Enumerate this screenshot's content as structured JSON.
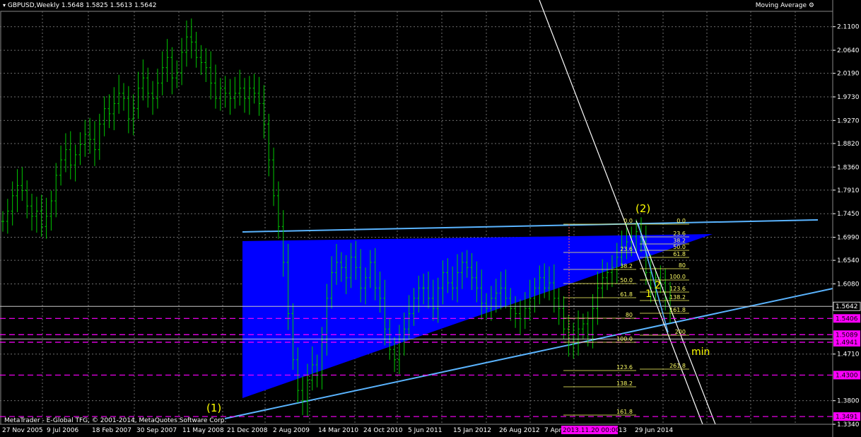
{
  "header": {
    "symbol_info": "GBPUSD,Weekly  1.5648 1.5825 1.5613 1.5642",
    "indicator": "Moving Average",
    "copyright": "MetaTrader - E-Global TFG, © 2001-2014, MetaQuotes Software Corp."
  },
  "colors": {
    "background": "#000000",
    "candles": "#00c800",
    "triangle": "#0000ff",
    "trendline": "#5ab4ff",
    "fib": "#ffff66",
    "magenta": "#ff00ff",
    "white": "#ffffff"
  },
  "chart_data": {
    "type": "candlestick",
    "symbol": "GBPUSD",
    "timeframe": "Weekly",
    "last_price": "1.5642",
    "ylim": [
      1.334,
      2.14
    ],
    "y_ticks": [
      "2.1100",
      "2.0640",
      "2.0190",
      "1.9730",
      "1.9270",
      "1.8820",
      "1.8360",
      "1.7910",
      "1.7450",
      "1.6990",
      "1.6540",
      "1.6080",
      "1.5642",
      "1.5406",
      "1.5089",
      "1.4941",
      "1.4710",
      "1.4300",
      "1.3800",
      "1.3491",
      "1.3340"
    ],
    "x_ticks": [
      "27 Nov 2005",
      "9 Jul 2006",
      "18 Feb 2007",
      "30 Sep 2007",
      "11 May 2008",
      "21 Dec 2008",
      "2 Aug 2009",
      "14 Mar 2010",
      "24 Oct 2010",
      "5 Jun 2011",
      "15 Jan 2012",
      "26 Aug 2012",
      "7 Apr",
      "2013.11.20 00:00",
      "13",
      "29 Jun 2014"
    ],
    "price_tags": [
      {
        "value": "1.5642",
        "style": "current"
      },
      {
        "value": "1.5406",
        "style": "magenta"
      },
      {
        "value": "1.5089",
        "style": "magenta"
      },
      {
        "value": "1.4941",
        "style": "magenta"
      },
      {
        "value": "1.4300",
        "style": "magenta"
      },
      {
        "value": "1.3491",
        "style": "magenta"
      }
    ],
    "fib_left_labels": [
      "0.0",
      "23.6",
      "38.2",
      "50.0",
      "61.8",
      "80",
      "100.0",
      "123.6",
      "138.2",
      "161.8"
    ],
    "fib_right_labels": [
      "0.0",
      "23.6",
      "38.2",
      "50.0",
      "61.8",
      "80",
      "100.0",
      "123.6",
      "138.2",
      "161.8",
      "200",
      "261.8"
    ],
    "annotations": [
      "(1)",
      "(2)",
      "1",
      "2",
      "min"
    ],
    "prices": [
      1.73,
      1.75,
      1.78,
      1.8,
      1.79,
      1.76,
      1.74,
      1.75,
      1.72,
      1.74,
      1.77,
      1.82,
      1.85,
      1.87,
      1.84,
      1.86,
      1.88,
      1.9,
      1.89,
      1.87,
      1.92,
      1.95,
      1.94,
      1.96,
      1.98,
      1.97,
      1.93,
      1.95,
      1.99,
      2.01,
      1.98,
      1.97,
      2.0,
      2.03,
      2.05,
      2.01,
      2.02,
      2.06,
      2.09,
      2.08,
      2.05,
      2.04,
      2.03,
      2.0,
      1.97,
      1.99,
      1.98,
      1.97,
      1.98,
      1.99,
      1.97,
      1.99,
      1.98,
      1.96,
      1.92,
      1.85,
      1.78,
      1.72,
      1.65,
      1.55,
      1.46,
      1.4,
      1.38,
      1.42,
      1.45,
      1.43,
      1.5,
      1.58,
      1.63,
      1.65,
      1.64,
      1.62,
      1.66,
      1.64,
      1.6,
      1.62,
      1.65,
      1.6,
      1.58,
      1.52,
      1.48,
      1.46,
      1.5,
      1.52,
      1.55,
      1.58,
      1.6,
      1.6,
      1.58,
      1.56,
      1.6,
      1.63,
      1.61,
      1.6,
      1.63,
      1.65,
      1.64,
      1.62,
      1.6,
      1.57,
      1.56,
      1.58,
      1.59,
      1.6,
      1.58,
      1.56,
      1.55,
      1.54,
      1.56,
      1.58,
      1.6,
      1.62,
      1.6,
      1.61,
      1.58,
      1.56,
      1.52,
      1.49,
      1.5,
      1.52,
      1.53,
      1.51,
      1.56,
      1.6,
      1.62,
      1.63,
      1.64,
      1.66,
      1.68,
      1.69,
      1.7,
      1.71,
      1.69,
      1.63,
      1.6,
      1.62,
      1.61,
      1.58,
      1.56
    ]
  }
}
